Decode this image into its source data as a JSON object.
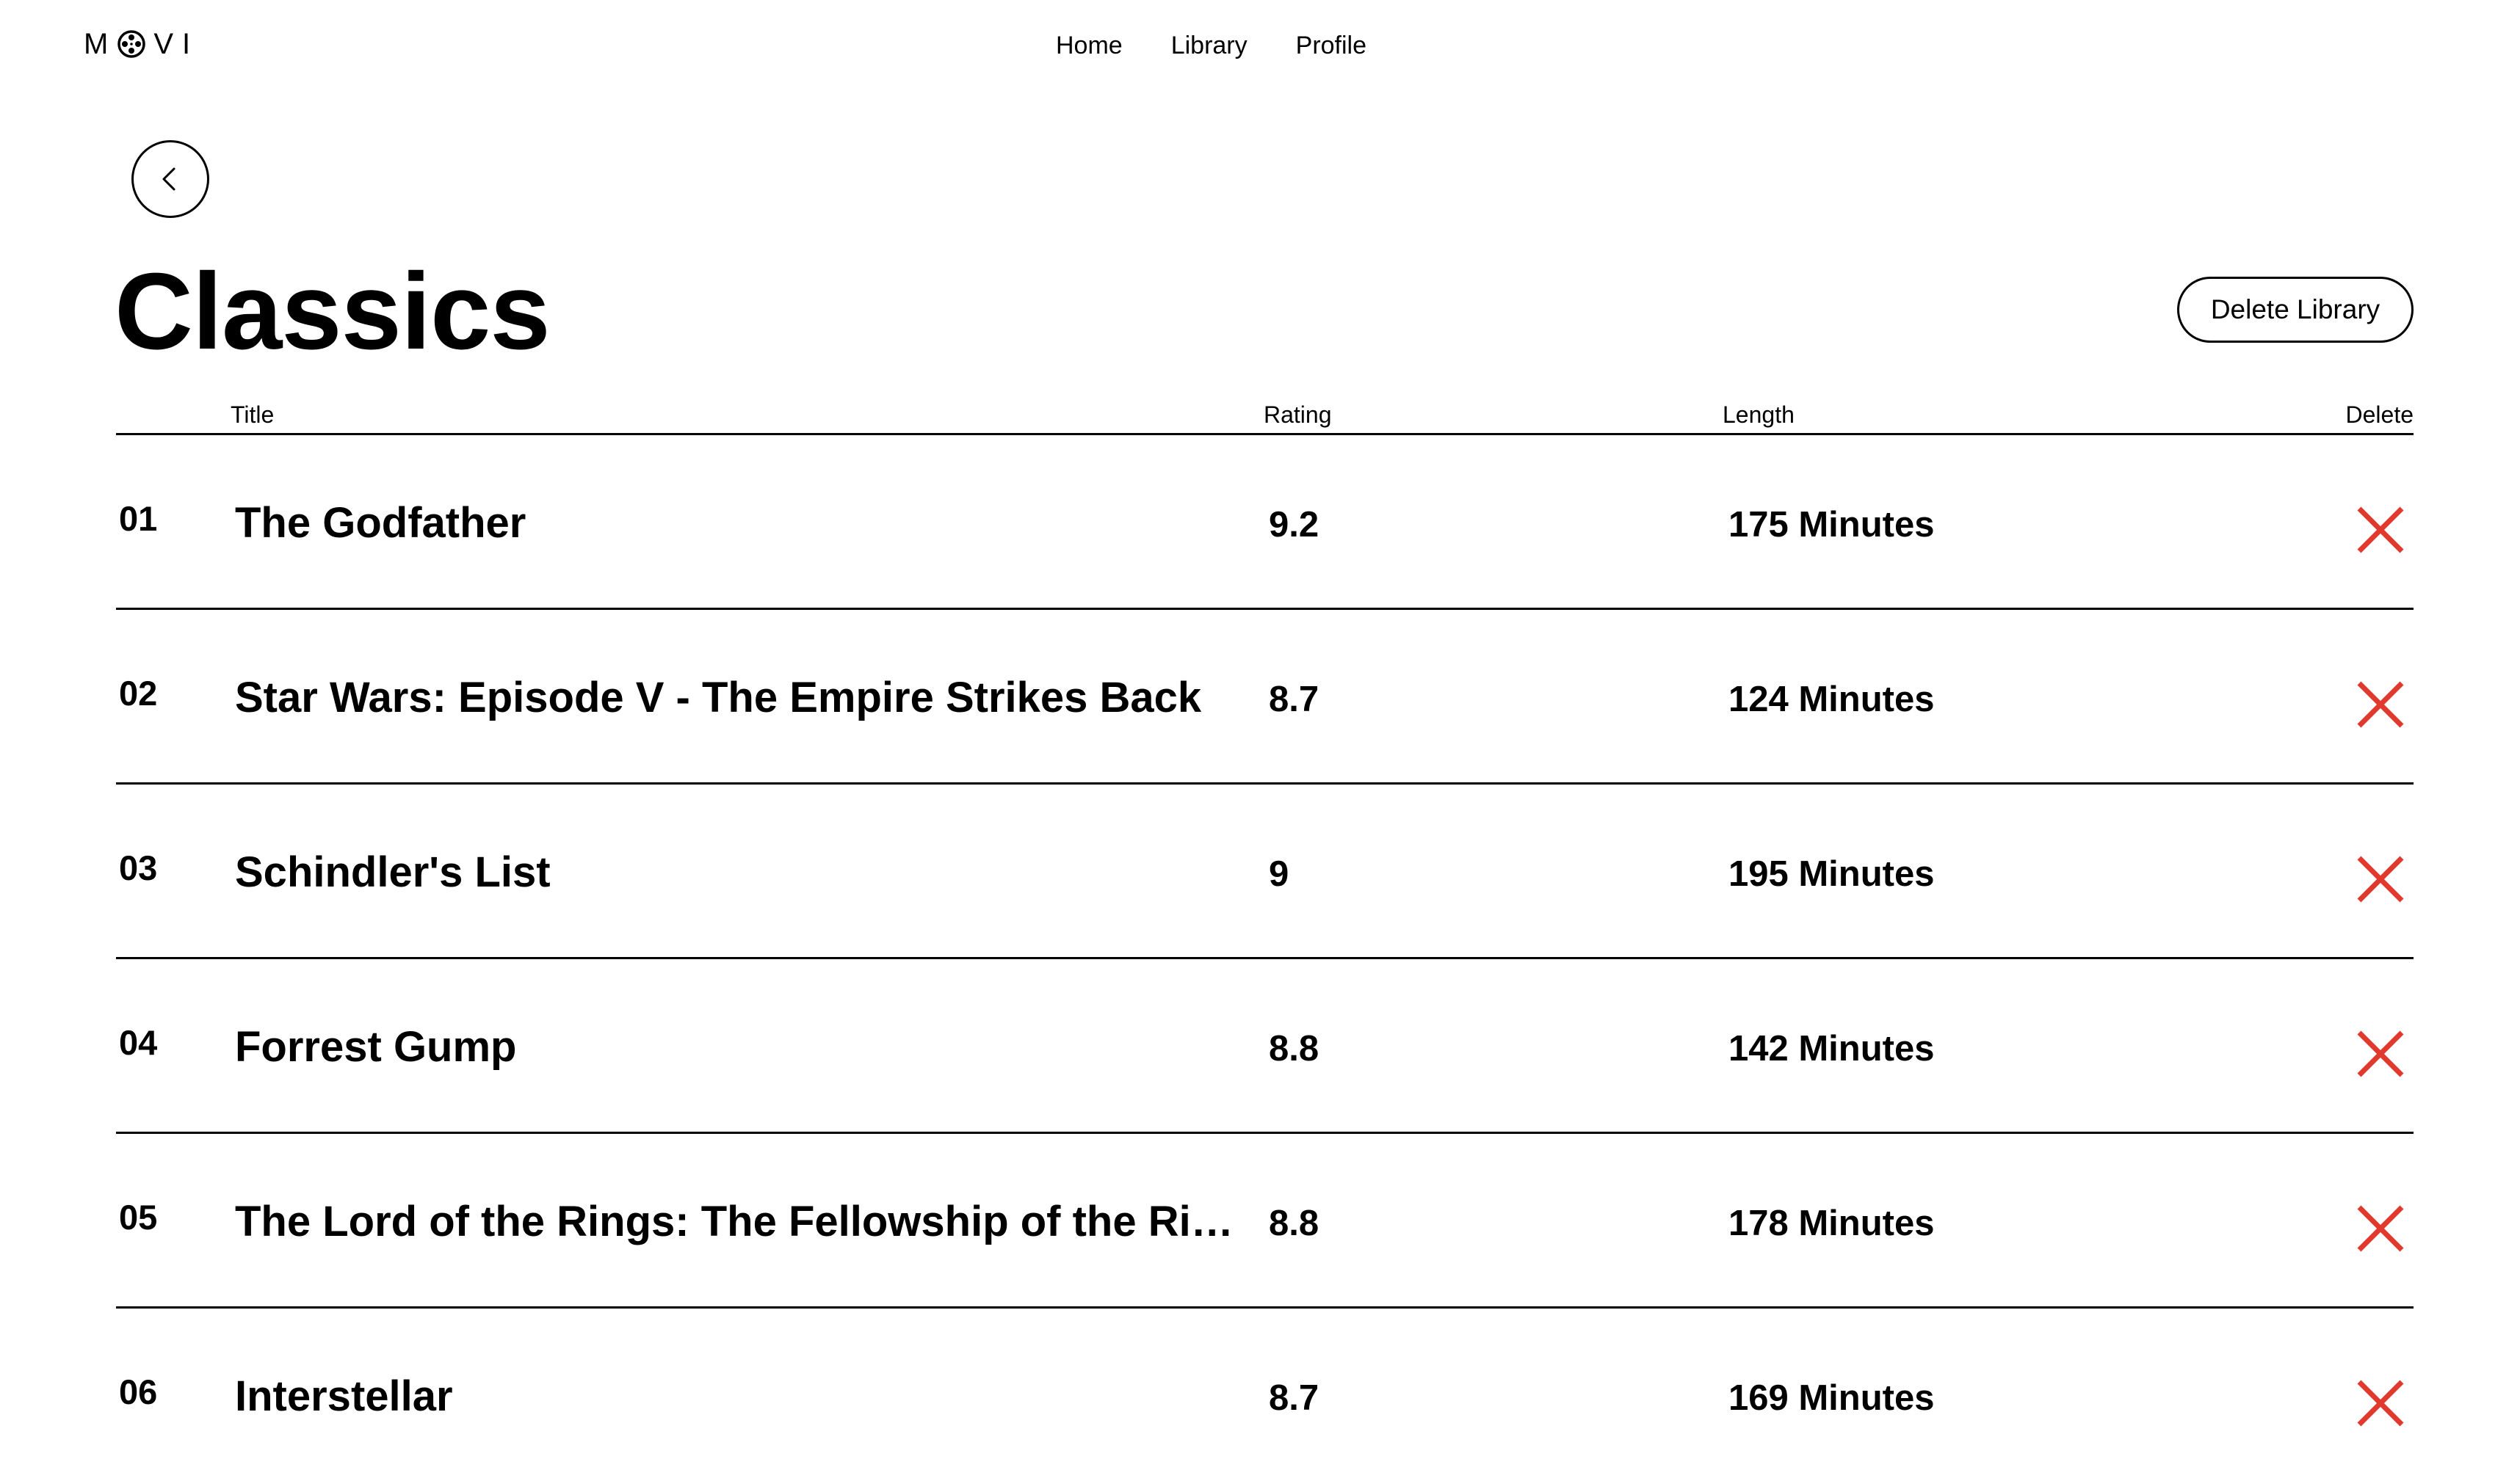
{
  "app": {
    "logo_text_left": "M",
    "logo_text_right": "VI"
  },
  "nav": {
    "items": [
      "Home",
      "Library",
      "Profile"
    ]
  },
  "page": {
    "title": "Classics",
    "delete_library_label": "Delete Library",
    "back_icon": "chevron-left-icon"
  },
  "table": {
    "headers": {
      "title": "Title",
      "rating": "Rating",
      "length": "Length",
      "delete": "Delete"
    },
    "rows": [
      {
        "index": "01",
        "title": "The Godfather",
        "rating": "9.2",
        "length": "175 Minutes"
      },
      {
        "index": "02",
        "title": "Star Wars: Episode V - The Empire Strikes Back",
        "rating": "8.7",
        "length": "124 Minutes"
      },
      {
        "index": "03",
        "title": "Schindler's List",
        "rating": "9",
        "length": "195 Minutes"
      },
      {
        "index": "04",
        "title": "Forrest Gump",
        "rating": "8.8",
        "length": "142 Minutes"
      },
      {
        "index": "05",
        "title": "The Lord of the Rings: The Fellowship of the Ri…",
        "rating": "8.8",
        "length": "178 Minutes"
      },
      {
        "index": "06",
        "title": "Interstellar",
        "rating": "8.7",
        "length": "169 Minutes"
      }
    ]
  },
  "colors": {
    "delete_icon": "#e03a2e",
    "text": "#000000",
    "background": "#ffffff"
  }
}
